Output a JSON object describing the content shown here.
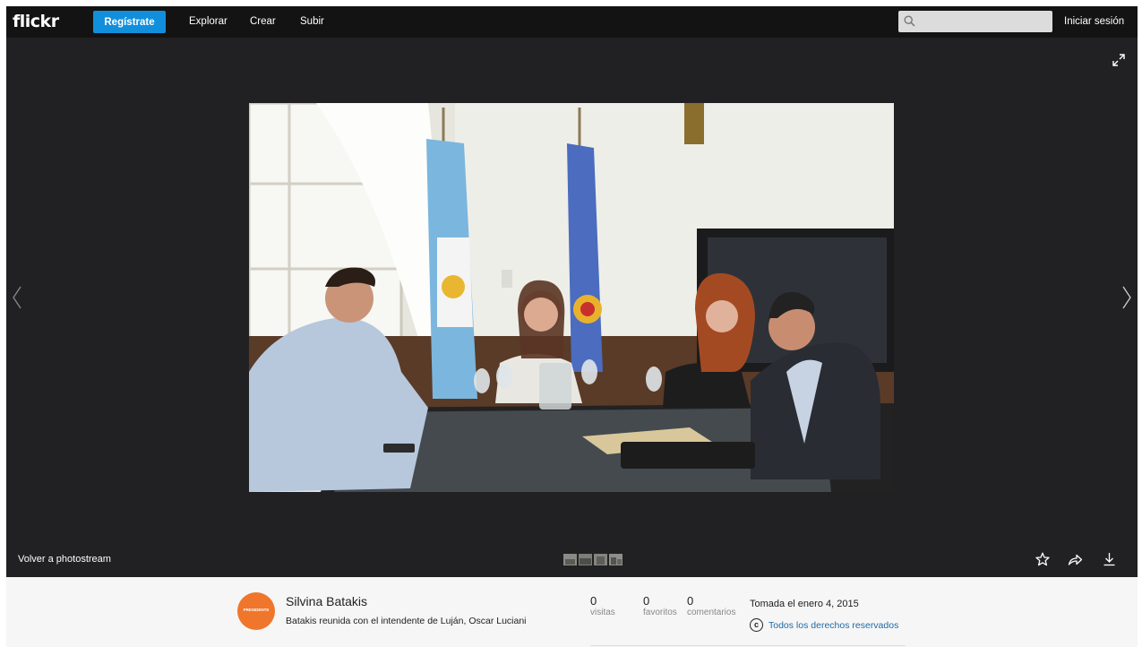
{
  "nav": {
    "logo": "flickr",
    "signup": "Regístrate",
    "links": [
      "Explorar",
      "Crear",
      "Subir"
    ],
    "search_placeholder": "",
    "login": "Iniciar sesión"
  },
  "viewer": {
    "back_link": "Volver a photostream"
  },
  "photo_info": {
    "avatar_text": "PRESIDENTE",
    "author": "Silvina Batakis",
    "description": "Batakis reunida con el intendente de Luján, Oscar Luciani",
    "stats": [
      {
        "value": "0",
        "label": "visitas"
      },
      {
        "value": "0",
        "label": "favoritos"
      },
      {
        "value": "0",
        "label": "comentarios"
      }
    ],
    "taken": "Tomada el enero 4, 2015",
    "license_icon": "c",
    "license": "Todos los derechos reservados"
  },
  "colors": {
    "brand_blue": "#128fdc",
    "stage_bg": "#212124",
    "nav_bg": "#131313",
    "avatar_orange": "#f0762b"
  }
}
